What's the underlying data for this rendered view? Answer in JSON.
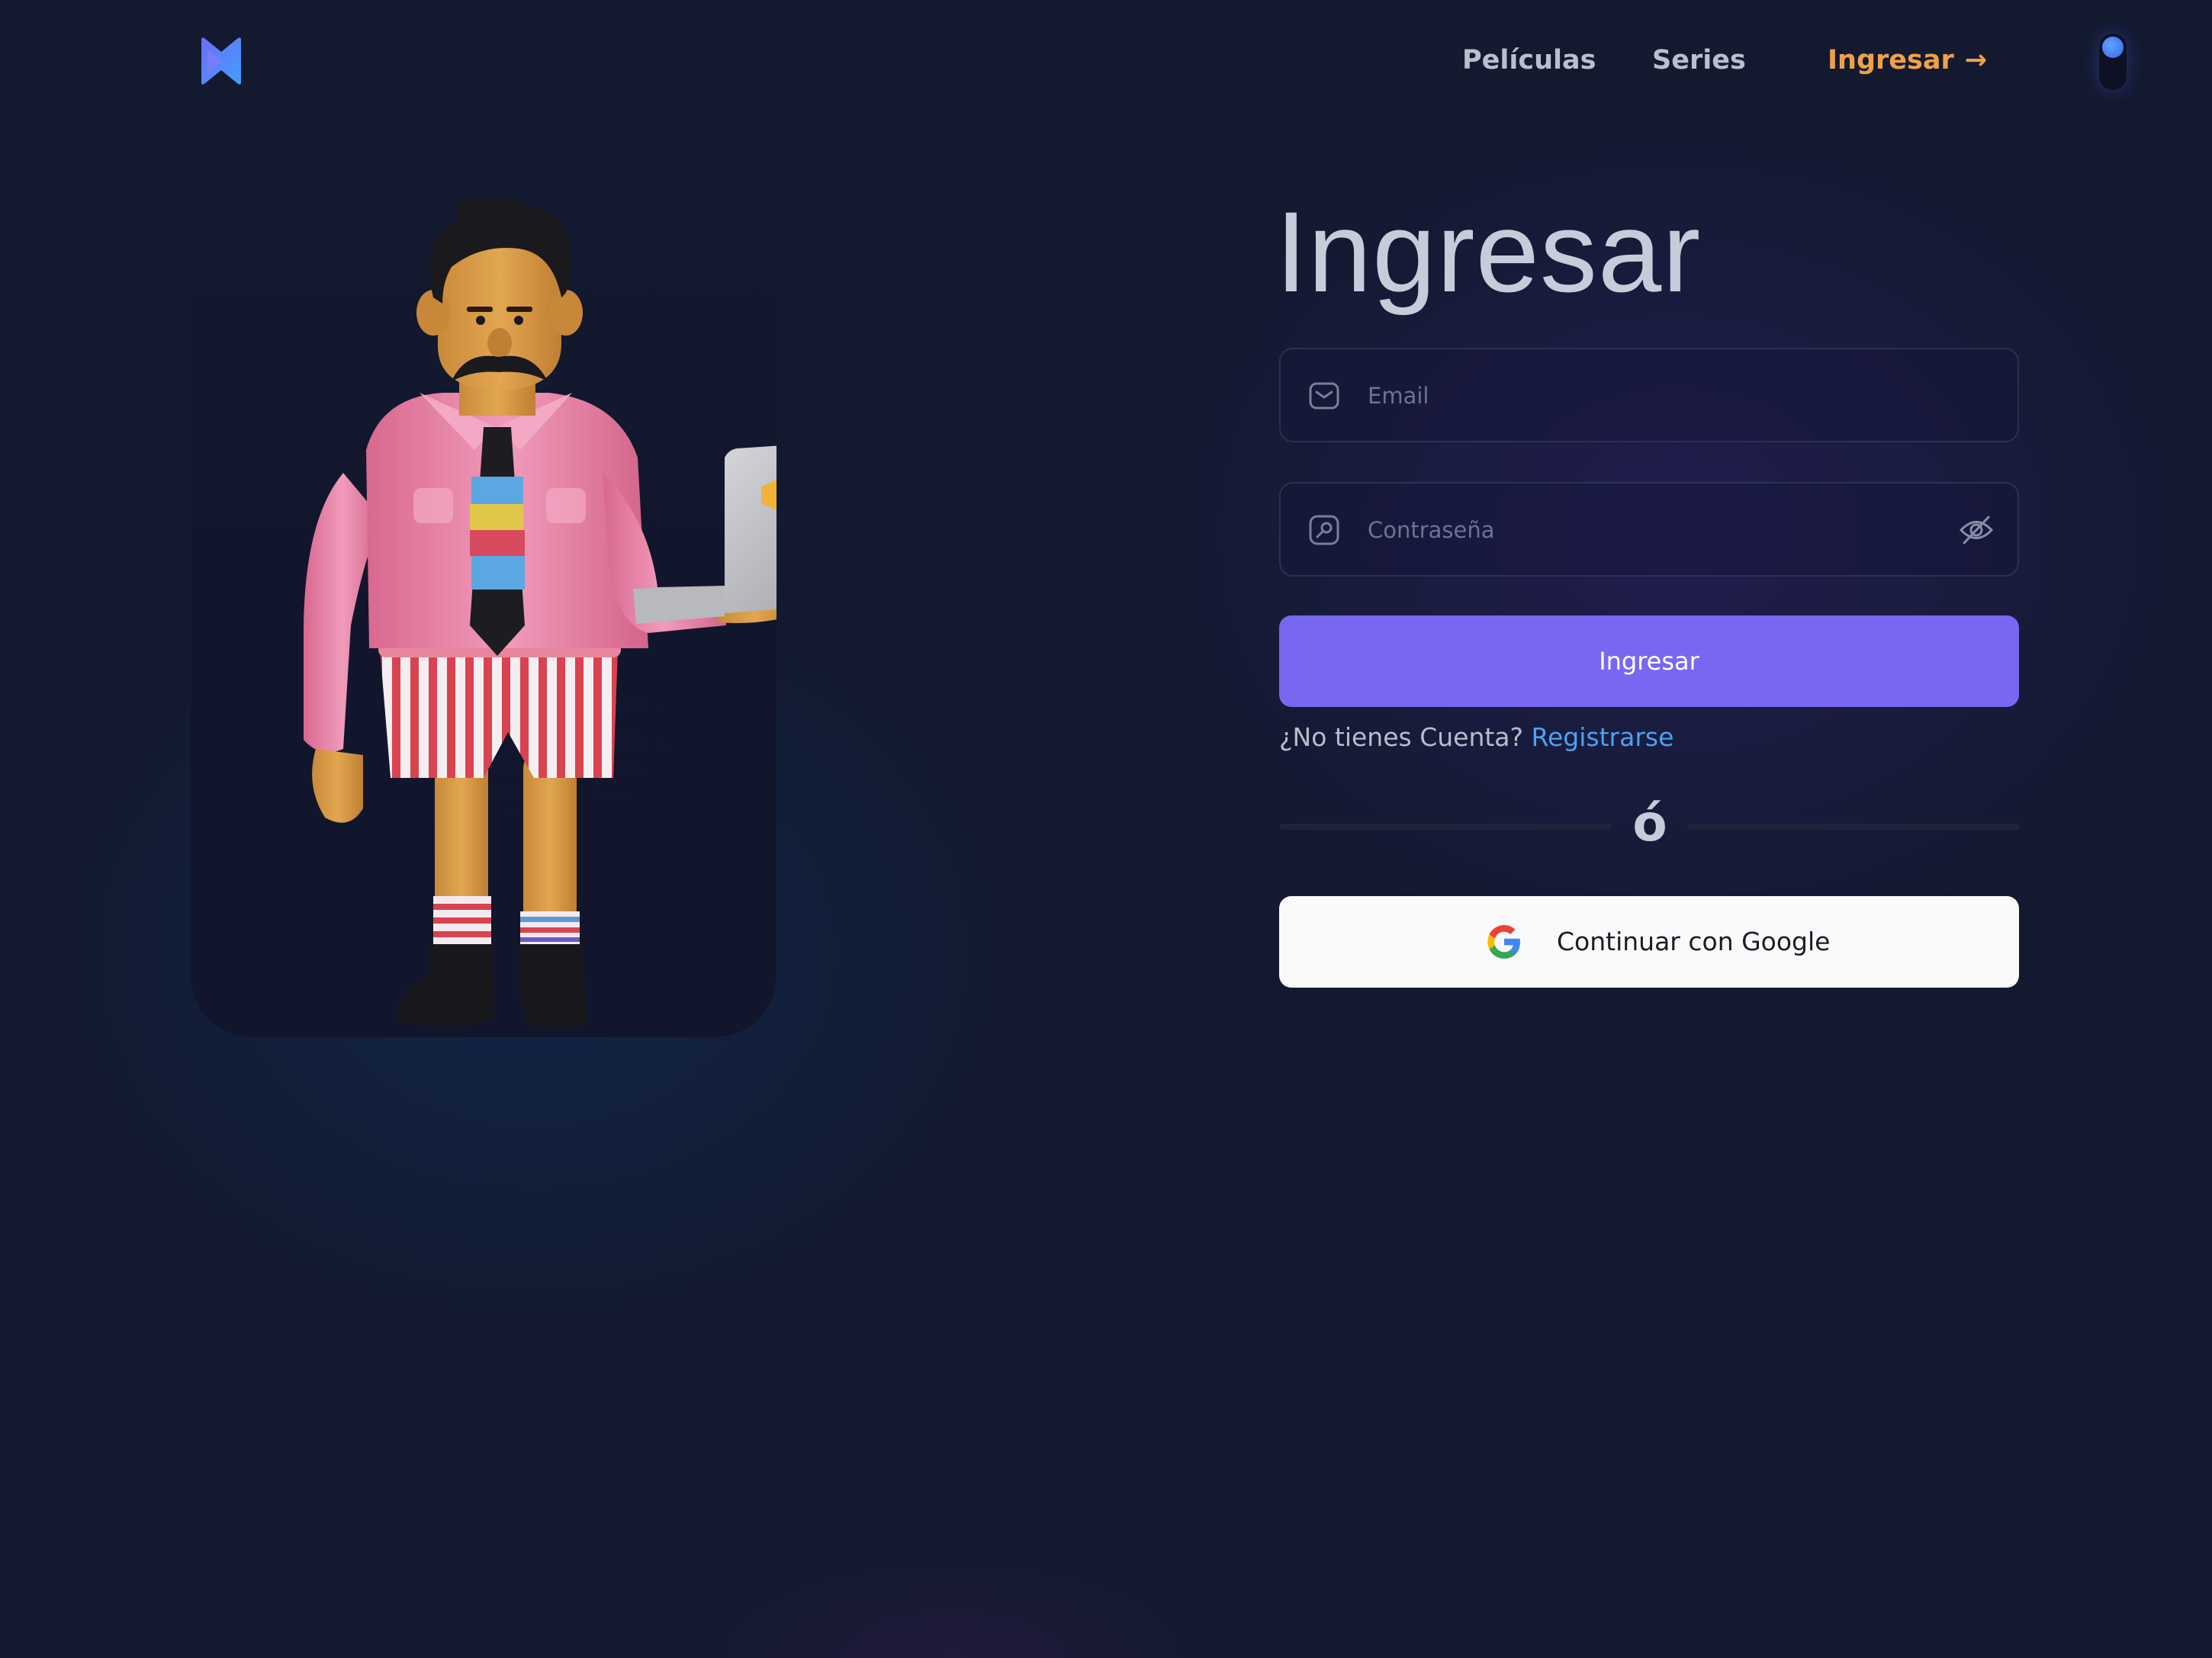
{
  "header": {
    "logo_icon": "brand-logo-icon",
    "nav": {
      "movies_label": "Películas",
      "series_label": "Series",
      "login_label": "Ingresar",
      "login_arrow": "→"
    },
    "theme_toggle_icon": "theme-toggle-icon"
  },
  "illustration": {
    "icon": "person-holding-laptop-illustration"
  },
  "login": {
    "title": "Ingresar",
    "email": {
      "icon": "mail-icon",
      "placeholder": "Email",
      "value": ""
    },
    "password": {
      "icon": "key-icon",
      "placeholder": "Contraseña",
      "value": "",
      "toggle_icon": "eye-off-icon"
    },
    "submit_label": "Ingresar",
    "register_prompt": "¿No tienes Cuenta?",
    "register_link": "Registrarse",
    "divider_text": "ó",
    "google_label": "Continuar con Google",
    "google_icon": "google-icon"
  },
  "colors": {
    "background": "#131a30",
    "accent": "#7967f2",
    "nav_active": "#f0a048",
    "link": "#4ea0f0",
    "button_text": "#ffffff"
  }
}
